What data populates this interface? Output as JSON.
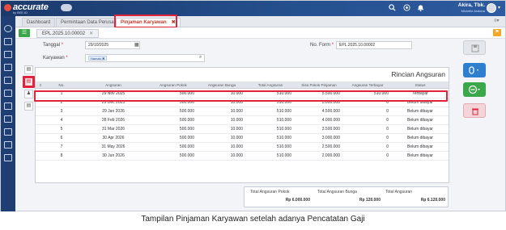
{
  "app": {
    "logo_text": "accurate",
    "logo_sub": "by BEE.ID",
    "user_company": "Akira, Tbk.",
    "user_name": "Michelle Ardiana"
  },
  "icons": {
    "header": [
      "search-icon",
      "help-icon",
      "bell-icon",
      "grid-icon"
    ],
    "sidebar": [
      "settings-icon",
      "building-icon",
      "document-icon",
      "monitor-icon",
      "box-icon",
      "cart-icon",
      "truck-icon",
      "bank-icon",
      "chart-icon",
      "report-icon",
      "calendar-icon"
    ]
  },
  "tabs": [
    {
      "label": "Dashboard"
    },
    {
      "label": "Permintaan Data Perusahaan"
    },
    {
      "label": "Pinjaman Karyawan",
      "active": true,
      "close": "✖"
    }
  ],
  "subtab": {
    "label": "EPL.2025.10.00002",
    "close": "✕"
  },
  "form": {
    "tanggal_label": "Tanggal",
    "tanggal_value": "29/10/2025",
    "karyawan_label": "Karyawan",
    "karyawan_chip": "Hamah",
    "karyawan_chip_close": "✖",
    "noform_label": "No. Form",
    "noform_value": "EPL.2025.10.00002"
  },
  "grid": {
    "title": "Rincian Angsuran",
    "columns": [
      "No.",
      "Angsuran",
      "Angsuran Pokok",
      "Angsuran Bunga",
      "Total Angsuran",
      "Sisa Pokok Pinjaman",
      "Angsuran Terbayar",
      "Status"
    ],
    "rows": [
      [
        "1",
        "29 Nov 2025",
        "500.000",
        "10.000",
        "510.000",
        "5.500.000",
        "510.000",
        "Terbayar"
      ],
      [
        "2",
        "29 Dec 2025",
        "500.000",
        "10.000",
        "510.000",
        "5.000.000",
        "0",
        "Belum dibayar"
      ],
      [
        "3",
        "29 Jan 2026",
        "500.000",
        "10.000",
        "510.000",
        "4.500.000",
        "0",
        "Belum dibayar"
      ],
      [
        "4",
        "28 Feb 2026",
        "500.000",
        "10.000",
        "510.000",
        "4.000.000",
        "0",
        "Belum dibayar"
      ],
      [
        "5",
        "31 Mar 2026",
        "500.000",
        "10.000",
        "510.000",
        "3.500.000",
        "0",
        "Belum dibayar"
      ],
      [
        "6",
        "30 Apr 2026",
        "500.000",
        "10.000",
        "510.000",
        "3.000.000",
        "0",
        "Belum dibayar"
      ],
      [
        "7",
        "31 May 2026",
        "500.000",
        "10.000",
        "510.000",
        "2.500.000",
        "0",
        "Belum dibayar"
      ],
      [
        "8",
        "30 Jun 2026",
        "500.000",
        "10.000",
        "510.000",
        "2.000.000",
        "0",
        "Belum dibayar"
      ]
    ]
  },
  "totals": [
    {
      "label": "Total Angsuran Pokok",
      "value": "Rp 6.000.000"
    },
    {
      "label": "Total Angsuran Bunga",
      "value": "Rp 120.000"
    },
    {
      "label": "Total Angsuran",
      "value": "Rp 6.120.000"
    }
  ],
  "caption": "Tampilan Pinjaman Karyawan setelah adanya Pencatatan Gaji",
  "colors": {
    "accent_red": "#e0233a",
    "header_blue": "#1f3f74",
    "green": "#3aa84a"
  }
}
